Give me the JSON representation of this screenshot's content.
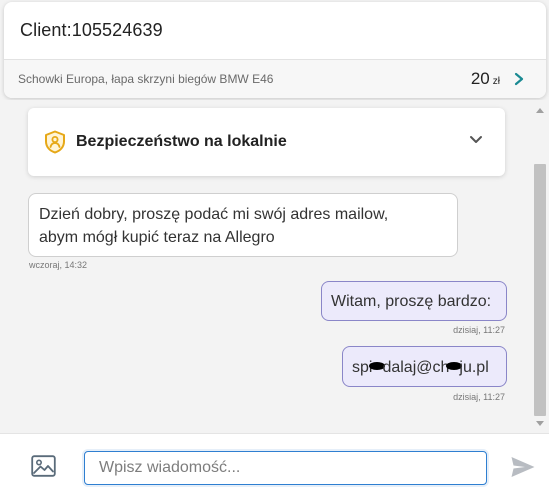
{
  "header": {
    "client_label": "Client:105524639",
    "offer_title": "Schowki Europa, łapa skrzyni biegów BMW E46",
    "offer_price": "20",
    "offer_currency": "zł"
  },
  "security": {
    "title": "Bezpieczeństwo na lokalnie"
  },
  "messages": [
    {
      "direction": "incoming",
      "line1": "Dzień dobry, proszę podać mi swój adres mailow,",
      "line2": "abym mógł kupić teraz na Allegro",
      "time": "wczoraj, 14:32"
    },
    {
      "direction": "outgoing",
      "text": "Witam, proszę bardzo:",
      "time": "dzisiaj, 11:27"
    },
    {
      "direction": "outgoing",
      "text_part1": "spi",
      "text_part2": "dalaj@ch",
      "text_part3": "ju.pl",
      "time": "dzisiaj, 11:27"
    }
  ],
  "composer": {
    "placeholder": "Wpisz wiadomość..."
  },
  "colors": {
    "accent": "#2f7fd1",
    "outgoing_bubble": "#eceafb",
    "outgoing_border": "#8a86c8",
    "shield": "#e6a817",
    "chevron_teal": "#1a8a93"
  },
  "icons": {
    "offer_chevron": "chevron-right-icon",
    "security_shield": "shield-user-icon",
    "security_chevron": "chevron-down-icon",
    "attach": "image-icon",
    "send": "send-icon"
  }
}
